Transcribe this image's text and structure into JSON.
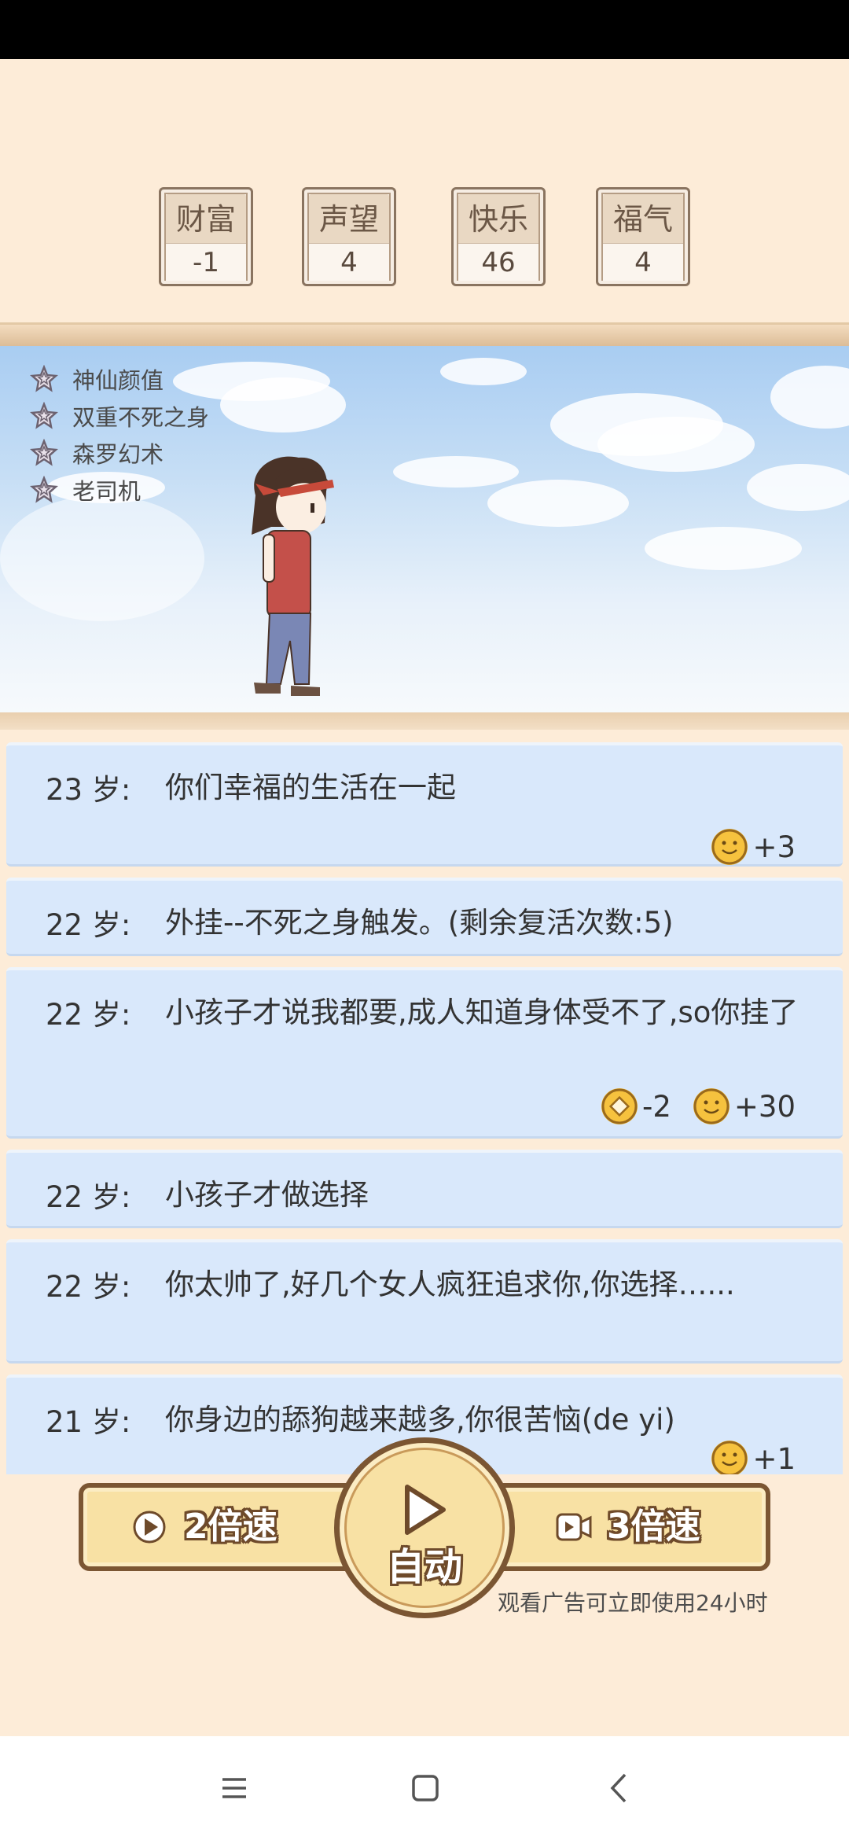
{
  "stats": [
    {
      "label": "财富",
      "value": "-1"
    },
    {
      "label": "声望",
      "value": "4"
    },
    {
      "label": "快乐",
      "value": "46"
    },
    {
      "label": "福气",
      "value": "4"
    }
  ],
  "talents": [
    "神仙颜值",
    "双重不死之身",
    "森罗幻术",
    "老司机"
  ],
  "log": [
    {
      "age": "23 岁:",
      "text": "你们幸福的生活在一起",
      "effects": [
        {
          "icon": "happy-icon",
          "value": "+3"
        }
      ]
    },
    {
      "age": "22 岁:",
      "text": "外挂--不死之身触发。(剩余复活次数:5)",
      "effects": []
    },
    {
      "age": "22 岁:",
      "text": "小孩子才说我都要,成人知道身体受不了,so你挂了",
      "effects": [
        {
          "icon": "coin-icon",
          "value": "-2"
        },
        {
          "icon": "happy-icon",
          "value": "+30"
        }
      ]
    },
    {
      "age": "22 岁:",
      "text": "小孩子才做选择",
      "effects": []
    },
    {
      "age": "22 岁:",
      "text": "你太帅了,好几个女人疯狂追求你,你选择…...",
      "effects": []
    },
    {
      "age": "21 岁:",
      "text": "你身边的舔狗越来越多,你很苦恼(de yi)",
      "effects": [
        {
          "icon": "happy-icon",
          "value": "+1"
        }
      ]
    }
  ],
  "controls": {
    "speed2_label": "2倍速",
    "auto_label": "自动",
    "speed3_label": "3倍速",
    "ad_note": "观看广告可立即使用24小时"
  },
  "colors": {
    "background": "#fdecd8",
    "log_entry": "#d9e8fb",
    "button_fill": "#f8e1a4",
    "button_border": "#7b5633"
  }
}
